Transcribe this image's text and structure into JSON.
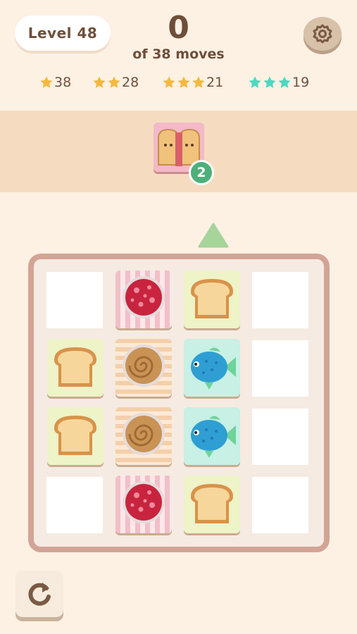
{
  "header": {
    "level_label": "Level 48",
    "moves_count": "0",
    "moves_label": "of 38 moves"
  },
  "star_goals": [
    {
      "stars": 1,
      "value": "38",
      "color": "#f5b841"
    },
    {
      "stars": 2,
      "value": "28",
      "color": "#f5b841"
    },
    {
      "stars": 3,
      "value": "21",
      "color": "#f5b841"
    },
    {
      "stars": 3,
      "value": "19",
      "color": "#4fd8c0"
    }
  ],
  "goal": {
    "item": "bread-sandwich",
    "remaining": "2"
  },
  "board": {
    "rows": 4,
    "cols": 4,
    "tiles": [
      [
        "empty",
        "salami",
        "bread",
        "empty"
      ],
      [
        "bread",
        "peanut-butter",
        "fish",
        "empty"
      ],
      [
        "bread",
        "peanut-butter",
        "fish",
        "empty"
      ],
      [
        "empty",
        "salami",
        "bread",
        "empty"
      ]
    ]
  },
  "icons": {
    "settings": "gear-icon",
    "undo": "undo-icon",
    "direction": "up-arrow-icon"
  },
  "colors": {
    "background": "#fdf1e4",
    "text": "#6e4f3a",
    "goal_badge": "#4db07a",
    "board_border": "#d3a495",
    "arrow": "#a7d49a"
  }
}
